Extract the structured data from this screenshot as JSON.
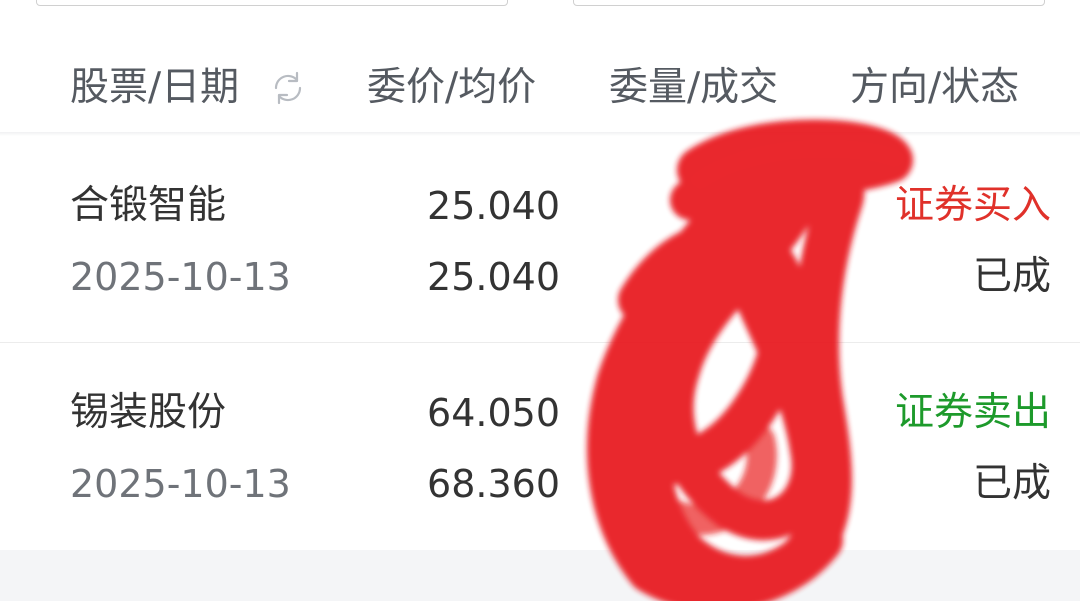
{
  "header": {
    "col_stock_date": "股票/日期",
    "col_price_avg": "委价/均价",
    "col_qty_deal": "委量/成交",
    "col_dir_status": "方向/状态",
    "refresh_icon": "refresh-icon"
  },
  "orders": [
    {
      "name": "合锻智能",
      "date": "2025-10-13",
      "order_price": "25.040",
      "avg_price": "25.040",
      "direction": "证券买入",
      "status": "已成"
    },
    {
      "name": "锡装股份",
      "date": "2025-10-13",
      "order_price": "64.050",
      "avg_price": "68.360",
      "direction": "证券卖出",
      "status": "已成"
    }
  ],
  "colors": {
    "buy": "#e0312a",
    "sell": "#1d9a2b",
    "scribble": "#e8191c"
  }
}
